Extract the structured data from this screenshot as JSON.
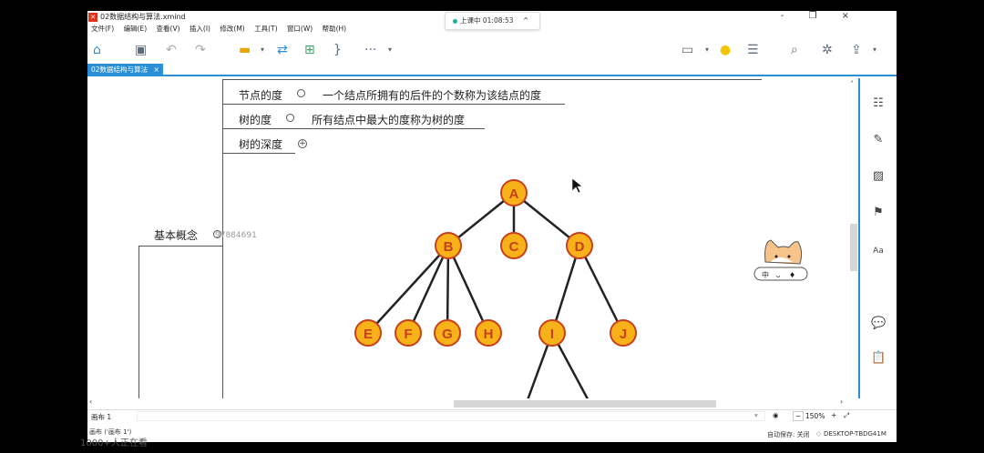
{
  "window": {
    "title": "02数据结构与算法.xmind",
    "controls": "- ❐ ×"
  },
  "menu": [
    "文件(F)",
    "编辑(E)",
    "查看(V)",
    "插入(I)",
    "修改(M)",
    "工具(T)",
    "窗口(W)",
    "帮助(H)"
  ],
  "status_pill": {
    "label": "上课中 01:08:53",
    "chevron": "^"
  },
  "tab": {
    "label": "02数据结构与算法",
    "close": "×"
  },
  "topics": {
    "node_degree": "节点的度",
    "node_degree_desc": "一个结点所拥有的后件的个数称为该结点的度",
    "tree_degree": "树的度",
    "tree_degree_desc": "所有结点中最大的度称为树的度",
    "tree_depth": "树的深度",
    "basic_concepts": "基本概念",
    "id_watermark": "97884691"
  },
  "tree": {
    "nodes": [
      "A",
      "B",
      "C",
      "D",
      "E",
      "F",
      "G",
      "H",
      "I",
      "J"
    ],
    "node_fill": "#f7b21a",
    "node_stroke": "#c6401c"
  },
  "sheet": {
    "label": "画布 1",
    "caption": "画布 ('画布 1')"
  },
  "zoom": {
    "value": "150%",
    "minus": "−",
    "plus": "+"
  },
  "statusbar": {
    "autosave": "自动保存: 关闭",
    "computer": "DESKTOP-TBDG41M"
  },
  "overlay": {
    "bilibili": "bilibili",
    "below_text": "1000+人正在看"
  },
  "colors": {
    "accent": "#2a8fd6",
    "node_fill": "#f7b21a"
  }
}
